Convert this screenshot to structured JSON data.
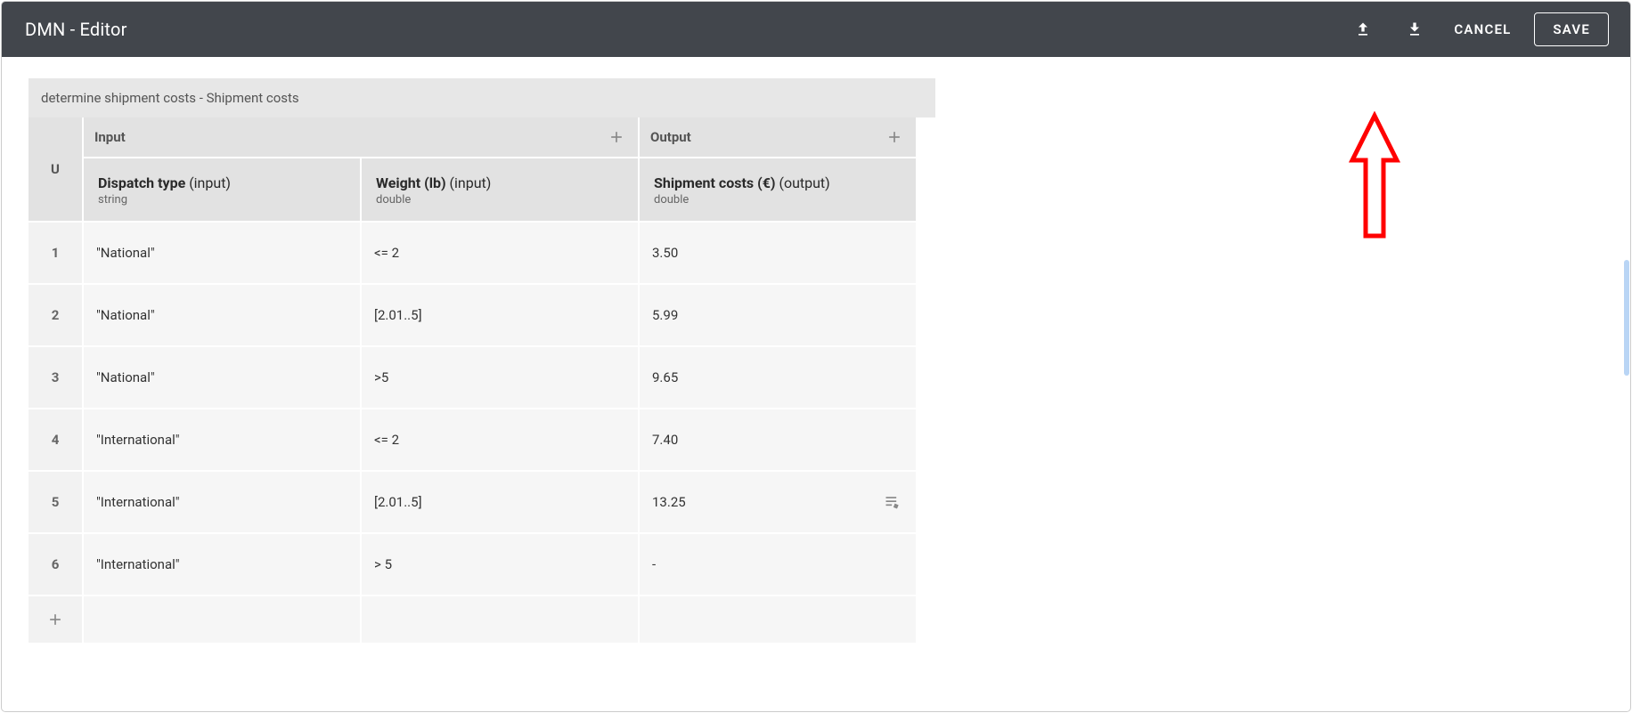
{
  "topbar": {
    "title": "DMN - Editor",
    "cancel_label": "CANCEL",
    "save_label": "SAVE"
  },
  "breadcrumb": "determine shipment costs - Shipment costs",
  "hit_policy": "U",
  "headers": {
    "input_group": "Input",
    "output_group": "Output",
    "columns": [
      {
        "name": "Dispatch type",
        "kind": "(input)",
        "type": "string"
      },
      {
        "name": "Weight (lb)",
        "kind": "(input)",
        "type": "double"
      },
      {
        "name": "Shipment costs (€)",
        "kind": "(output)",
        "type": "double"
      }
    ]
  },
  "rows": [
    {
      "num": "1",
      "dispatch": "\"National\"",
      "weight": "<= 2",
      "cost": "3.50",
      "has_action": false
    },
    {
      "num": "2",
      "dispatch": "\"National\"",
      "weight": "[2.01..5]",
      "cost": "5.99",
      "has_action": false
    },
    {
      "num": "3",
      "dispatch": "\"National\"",
      "weight": ">5",
      "cost": "9.65",
      "has_action": false
    },
    {
      "num": "4",
      "dispatch": "\"International\"",
      "weight": "<= 2",
      "cost": "7.40",
      "has_action": false
    },
    {
      "num": "5",
      "dispatch": "\"International\"",
      "weight": "[2.01..5]",
      "cost": "13.25",
      "has_action": true
    },
    {
      "num": "6",
      "dispatch": "\"International\"",
      "weight": "> 5",
      "cost": "-",
      "has_action": false
    }
  ]
}
